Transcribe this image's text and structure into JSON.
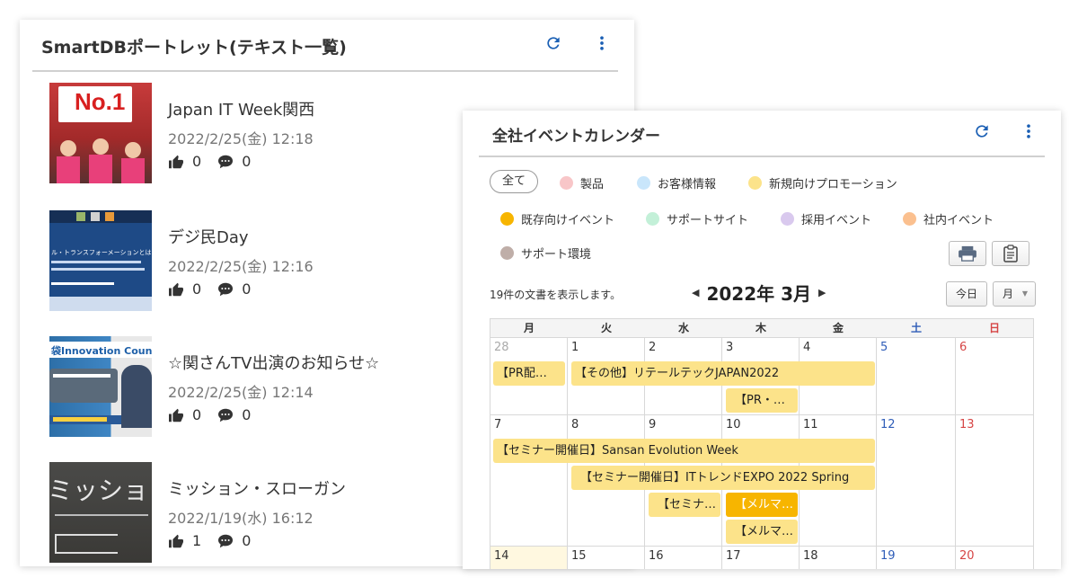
{
  "portlet_left": {
    "title": "SmartDBポートレット(テキスト一覧)",
    "posts": [
      {
        "title": "Japan IT Week関西",
        "date": "2022/2/25(金) 12:18",
        "likes": "0",
        "comments": "0",
        "thumb_text": "No.1"
      },
      {
        "title": "デジ民Day",
        "date": "2022/2/25(金) 12:16",
        "likes": "0",
        "comments": "0",
        "thumb_text": "ル・トランスフォーメーションとは"
      },
      {
        "title": "☆関さんTV出演のお知らせ☆",
        "date": "2022/2/25(金) 12:14",
        "likes": "0",
        "comments": "0",
        "thumb_text": "袋Innovation Council"
      },
      {
        "title": "ミッション・スローガン",
        "date": "2022/1/19(水) 16:12",
        "likes": "1",
        "comments": "0",
        "thumb_text": "ミッション"
      }
    ]
  },
  "portlet_right": {
    "title": "全社イベントカレンダー",
    "legend_all": "全て",
    "legend": [
      {
        "label": "製品",
        "color": "#f8c6c8"
      },
      {
        "label": "お客様情報",
        "color": "#c9e6fb"
      },
      {
        "label": "新規向けプロモーション",
        "color": "#fce38a"
      },
      {
        "label": "既存向けイベント",
        "color": "#f7b500"
      },
      {
        "label": "サポートサイト",
        "color": "#c3f0d8"
      },
      {
        "label": "採用イベント",
        "color": "#d9c9ee"
      },
      {
        "label": "社内イベント",
        "color": "#fbc08f"
      },
      {
        "label": "サポート環境",
        "color": "#bfaea8"
      }
    ],
    "doc_count": "19件の文書を表示します。",
    "month_title": "2022年 3月",
    "today_label": "今日",
    "view_label": "月",
    "weekdays": [
      "月",
      "火",
      "水",
      "木",
      "金",
      "土",
      "日"
    ],
    "weeks": [
      {
        "days": [
          "28",
          "1",
          "2",
          "3",
          "4",
          "5",
          "6"
        ]
      },
      {
        "days": [
          "7",
          "8",
          "9",
          "10",
          "11",
          "12",
          "13"
        ]
      },
      {
        "days": [
          "14",
          "15",
          "16",
          "17",
          "18",
          "19",
          "20"
        ]
      }
    ],
    "events": [
      {
        "label": "【PR配…",
        "color": "#fce38a"
      },
      {
        "label": "【その他】リテールテックJAPAN2022",
        "color": "#fce38a"
      },
      {
        "label": "【PR・…",
        "color": "#fce38a"
      },
      {
        "label": "【セミナー開催日】Sansan Evolution Week",
        "color": "#fce38a"
      },
      {
        "label": "【セミナー開催日】ITトレンドEXPO 2022 Spring",
        "color": "#fce38a"
      },
      {
        "label": "【セミナ…",
        "color": "#fce38a"
      },
      {
        "label": "【メルマ…",
        "color": "#f7b500"
      },
      {
        "label": "【メルマ…",
        "color": "#fce38a"
      }
    ]
  }
}
